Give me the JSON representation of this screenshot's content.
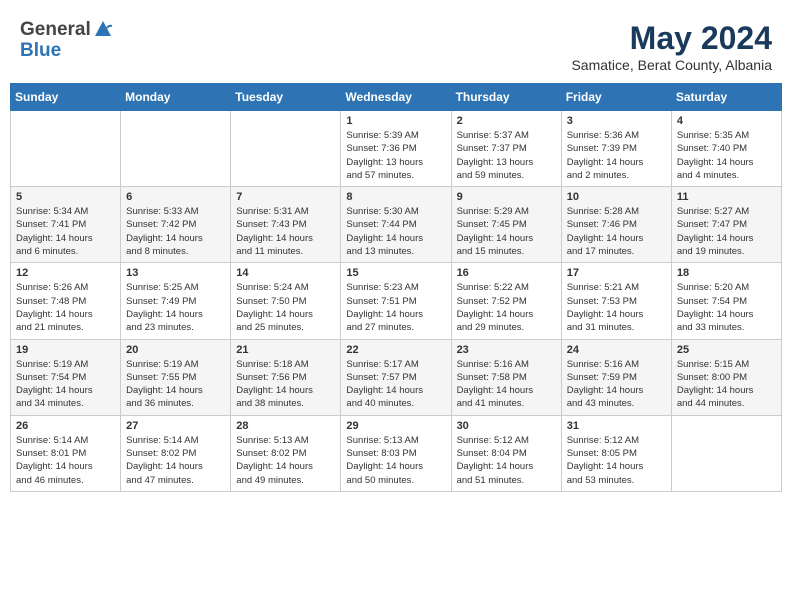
{
  "header": {
    "logo_general": "General",
    "logo_blue": "Blue",
    "month_year": "May 2024",
    "location": "Samatice, Berat County, Albania"
  },
  "days_of_week": [
    "Sunday",
    "Monday",
    "Tuesday",
    "Wednesday",
    "Thursday",
    "Friday",
    "Saturday"
  ],
  "weeks": [
    [
      {
        "day": "",
        "content": ""
      },
      {
        "day": "",
        "content": ""
      },
      {
        "day": "",
        "content": ""
      },
      {
        "day": "1",
        "content": "Sunrise: 5:39 AM\nSunset: 7:36 PM\nDaylight: 13 hours\nand 57 minutes."
      },
      {
        "day": "2",
        "content": "Sunrise: 5:37 AM\nSunset: 7:37 PM\nDaylight: 13 hours\nand 59 minutes."
      },
      {
        "day": "3",
        "content": "Sunrise: 5:36 AM\nSunset: 7:39 PM\nDaylight: 14 hours\nand 2 minutes."
      },
      {
        "day": "4",
        "content": "Sunrise: 5:35 AM\nSunset: 7:40 PM\nDaylight: 14 hours\nand 4 minutes."
      }
    ],
    [
      {
        "day": "5",
        "content": "Sunrise: 5:34 AM\nSunset: 7:41 PM\nDaylight: 14 hours\nand 6 minutes."
      },
      {
        "day": "6",
        "content": "Sunrise: 5:33 AM\nSunset: 7:42 PM\nDaylight: 14 hours\nand 8 minutes."
      },
      {
        "day": "7",
        "content": "Sunrise: 5:31 AM\nSunset: 7:43 PM\nDaylight: 14 hours\nand 11 minutes."
      },
      {
        "day": "8",
        "content": "Sunrise: 5:30 AM\nSunset: 7:44 PM\nDaylight: 14 hours\nand 13 minutes."
      },
      {
        "day": "9",
        "content": "Sunrise: 5:29 AM\nSunset: 7:45 PM\nDaylight: 14 hours\nand 15 minutes."
      },
      {
        "day": "10",
        "content": "Sunrise: 5:28 AM\nSunset: 7:46 PM\nDaylight: 14 hours\nand 17 minutes."
      },
      {
        "day": "11",
        "content": "Sunrise: 5:27 AM\nSunset: 7:47 PM\nDaylight: 14 hours\nand 19 minutes."
      }
    ],
    [
      {
        "day": "12",
        "content": "Sunrise: 5:26 AM\nSunset: 7:48 PM\nDaylight: 14 hours\nand 21 minutes."
      },
      {
        "day": "13",
        "content": "Sunrise: 5:25 AM\nSunset: 7:49 PM\nDaylight: 14 hours\nand 23 minutes."
      },
      {
        "day": "14",
        "content": "Sunrise: 5:24 AM\nSunset: 7:50 PM\nDaylight: 14 hours\nand 25 minutes."
      },
      {
        "day": "15",
        "content": "Sunrise: 5:23 AM\nSunset: 7:51 PM\nDaylight: 14 hours\nand 27 minutes."
      },
      {
        "day": "16",
        "content": "Sunrise: 5:22 AM\nSunset: 7:52 PM\nDaylight: 14 hours\nand 29 minutes."
      },
      {
        "day": "17",
        "content": "Sunrise: 5:21 AM\nSunset: 7:53 PM\nDaylight: 14 hours\nand 31 minutes."
      },
      {
        "day": "18",
        "content": "Sunrise: 5:20 AM\nSunset: 7:54 PM\nDaylight: 14 hours\nand 33 minutes."
      }
    ],
    [
      {
        "day": "19",
        "content": "Sunrise: 5:19 AM\nSunset: 7:54 PM\nDaylight: 14 hours\nand 34 minutes."
      },
      {
        "day": "20",
        "content": "Sunrise: 5:19 AM\nSunset: 7:55 PM\nDaylight: 14 hours\nand 36 minutes."
      },
      {
        "day": "21",
        "content": "Sunrise: 5:18 AM\nSunset: 7:56 PM\nDaylight: 14 hours\nand 38 minutes."
      },
      {
        "day": "22",
        "content": "Sunrise: 5:17 AM\nSunset: 7:57 PM\nDaylight: 14 hours\nand 40 minutes."
      },
      {
        "day": "23",
        "content": "Sunrise: 5:16 AM\nSunset: 7:58 PM\nDaylight: 14 hours\nand 41 minutes."
      },
      {
        "day": "24",
        "content": "Sunrise: 5:16 AM\nSunset: 7:59 PM\nDaylight: 14 hours\nand 43 minutes."
      },
      {
        "day": "25",
        "content": "Sunrise: 5:15 AM\nSunset: 8:00 PM\nDaylight: 14 hours\nand 44 minutes."
      }
    ],
    [
      {
        "day": "26",
        "content": "Sunrise: 5:14 AM\nSunset: 8:01 PM\nDaylight: 14 hours\nand 46 minutes."
      },
      {
        "day": "27",
        "content": "Sunrise: 5:14 AM\nSunset: 8:02 PM\nDaylight: 14 hours\nand 47 minutes."
      },
      {
        "day": "28",
        "content": "Sunrise: 5:13 AM\nSunset: 8:02 PM\nDaylight: 14 hours\nand 49 minutes."
      },
      {
        "day": "29",
        "content": "Sunrise: 5:13 AM\nSunset: 8:03 PM\nDaylight: 14 hours\nand 50 minutes."
      },
      {
        "day": "30",
        "content": "Sunrise: 5:12 AM\nSunset: 8:04 PM\nDaylight: 14 hours\nand 51 minutes."
      },
      {
        "day": "31",
        "content": "Sunrise: 5:12 AM\nSunset: 8:05 PM\nDaylight: 14 hours\nand 53 minutes."
      },
      {
        "day": "",
        "content": ""
      }
    ]
  ]
}
